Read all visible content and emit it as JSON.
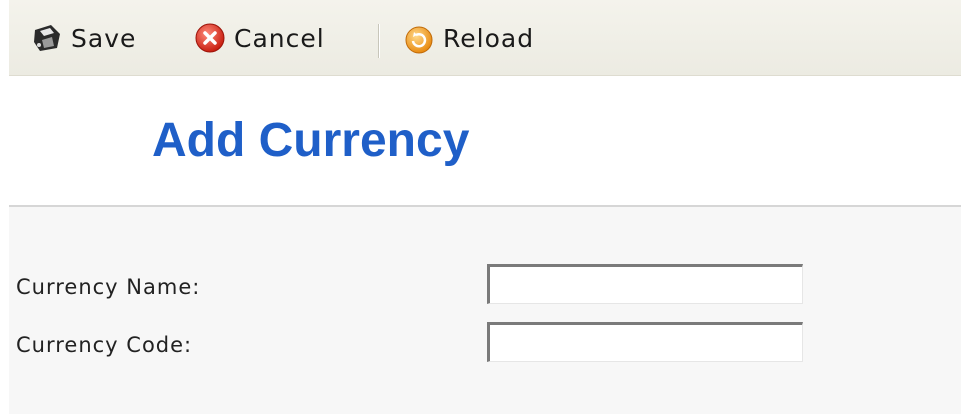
{
  "toolbar": {
    "save_label": "Save",
    "cancel_label": "Cancel",
    "reload_label": "Reload",
    "save_icon": "floppy-disk-icon",
    "cancel_icon": "red-x-circle-icon",
    "reload_icon": "orange-refresh-icon"
  },
  "page": {
    "title": "Add Currency"
  },
  "form": {
    "currency_name_label": "Currency Name:",
    "currency_name_value": "",
    "currency_code_label": "Currency Code:",
    "currency_code_value": ""
  },
  "colors": {
    "title": "#1f5fc8",
    "toolbar_bg": "#f0efe7",
    "form_bg": "#f7f7f7"
  }
}
